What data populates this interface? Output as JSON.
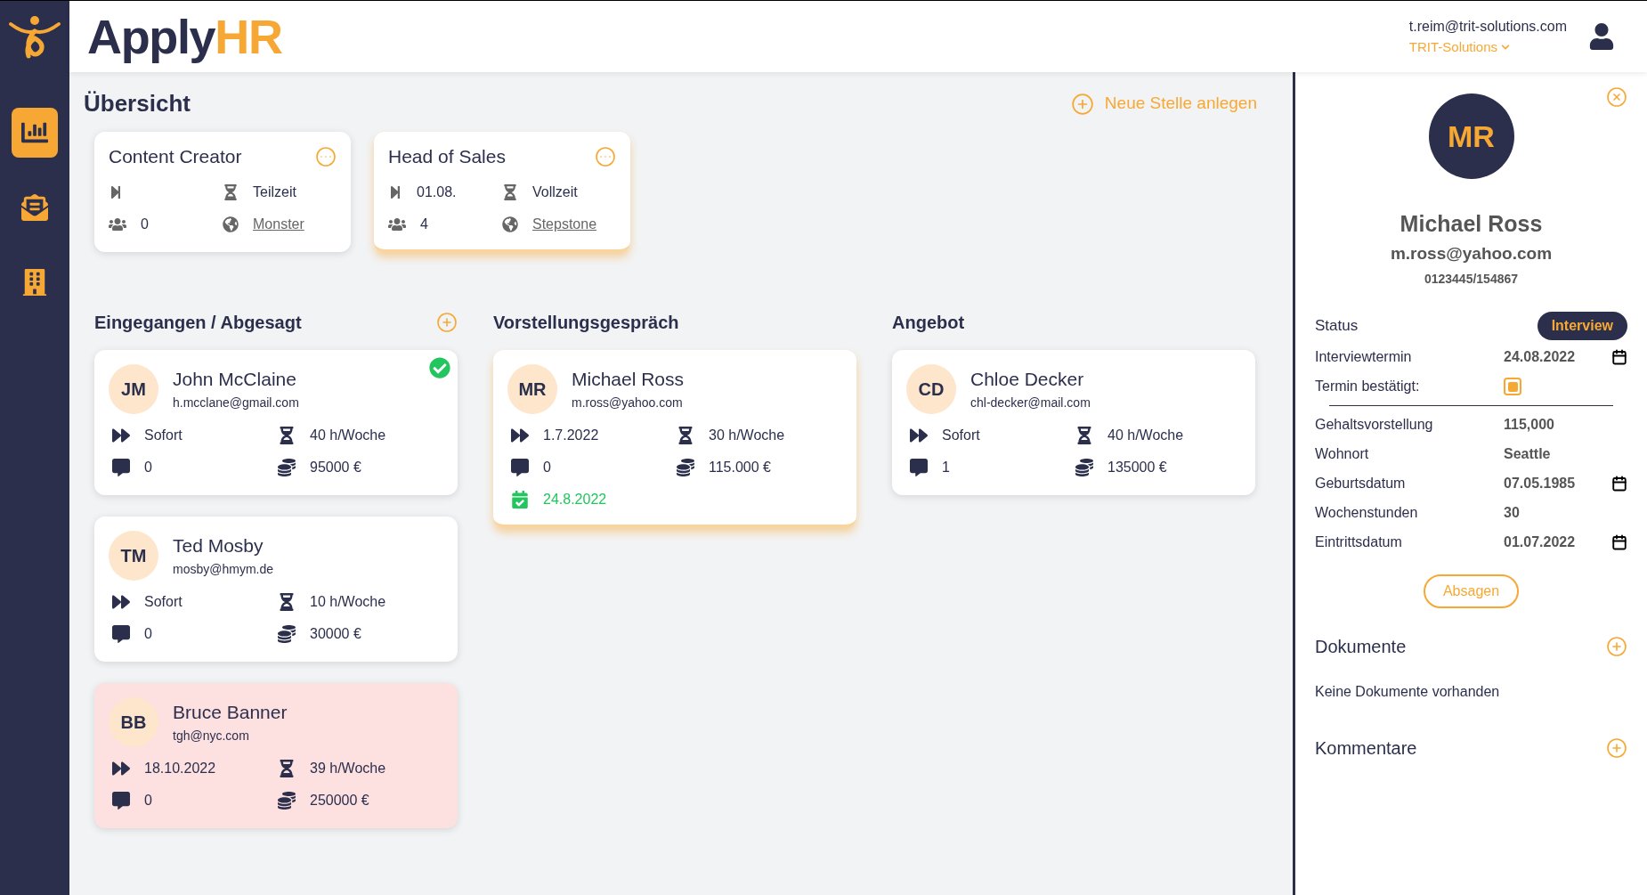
{
  "nav": [
    {
      "selected": true
    },
    {
      "selected": false
    },
    {
      "selected": false
    }
  ],
  "header": {
    "logo_dark": "Apply",
    "logo_accent": "HR",
    "user_email": "t.reim@trit-solutions.com",
    "company": "TRIT-Solutions"
  },
  "overview": {
    "title": "Übersicht",
    "new_job": "Neue Stelle anlegen"
  },
  "jobs": [
    {
      "title": "Content Creator",
      "type": "Teilzeit",
      "applicants": "0",
      "source": "Monster",
      "selected": false
    },
    {
      "title": "Head of Sales",
      "start": "01.08.",
      "type": "Vollzeit",
      "applicants": "4",
      "source": "Stepstone",
      "selected": true
    }
  ],
  "columns": [
    {
      "title": "Eingegangen / Abgesagt",
      "addable": true,
      "candidates": [
        {
          "initials": "JM",
          "name": "John McClaine",
          "email": "h.mcclane@gmail.com",
          "start": "Sofort",
          "hours": "40 h/Woche",
          "comments": "0",
          "salary": "95000 €",
          "confirmed": true,
          "rejected": false,
          "selected": false
        },
        {
          "initials": "TM",
          "name": "Ted Mosby",
          "email": "mosby@hmym.de",
          "start": "Sofort",
          "hours": "10 h/Woche",
          "comments": "0",
          "salary": "30000 €",
          "confirmed": false,
          "rejected": false,
          "selected": false
        },
        {
          "initials": "BB",
          "name": "Bruce Banner",
          "email": "tgh@nyc.com",
          "start": "18.10.2022",
          "hours": "39 h/Woche",
          "comments": "0",
          "salary": "250000 €",
          "confirmed": false,
          "rejected": true,
          "selected": false
        }
      ]
    },
    {
      "title": "Vorstellungsgespräch",
      "addable": false,
      "candidates": [
        {
          "initials": "MR",
          "name": "Michael Ross",
          "email": "m.ross@yahoo.com",
          "start": "1.7.2022",
          "hours": "30 h/Woche",
          "comments": "0",
          "salary": "115.000 €",
          "interview_date": "24.8.2022",
          "confirmed": false,
          "rejected": false,
          "selected": true
        }
      ]
    },
    {
      "title": "Angebot",
      "addable": false,
      "candidates": [
        {
          "initials": "CD",
          "name": "Chloe Decker",
          "email": "chl-decker@mail.com",
          "start": "Sofort",
          "hours": "40 h/Woche",
          "comments": "1",
          "salary": "135000 €",
          "confirmed": false,
          "rejected": false,
          "selected": false
        }
      ]
    }
  ],
  "detail": {
    "initials": "MR",
    "name": "Michael Ross",
    "email": "m.ross@yahoo.com",
    "phone": "0123445/154867",
    "status_label": "Status",
    "status": "Interview",
    "fields": [
      {
        "kind": "date",
        "label": "Interviewtermin",
        "value": "24.08.2022"
      },
      {
        "kind": "checkbox",
        "label": "Termin bestätigt:",
        "checked": true
      },
      {
        "kind": "divider"
      },
      {
        "kind": "text",
        "label": "Gehaltsvorstellung",
        "value": "115,000"
      },
      {
        "kind": "text",
        "label": "Wohnort",
        "value": "Seattle"
      },
      {
        "kind": "date",
        "label": "Geburtsdatum",
        "value": "07.05.1985"
      },
      {
        "kind": "text",
        "label": "Wochenstunden",
        "value": "30"
      },
      {
        "kind": "date",
        "label": "Eintrittsdatum",
        "value": "01.07.2022"
      }
    ],
    "reject": "Absagen",
    "documents_title": "Dokumente",
    "documents_empty": "Keine Dokumente vorhanden",
    "comments_title": "Kommentare"
  }
}
